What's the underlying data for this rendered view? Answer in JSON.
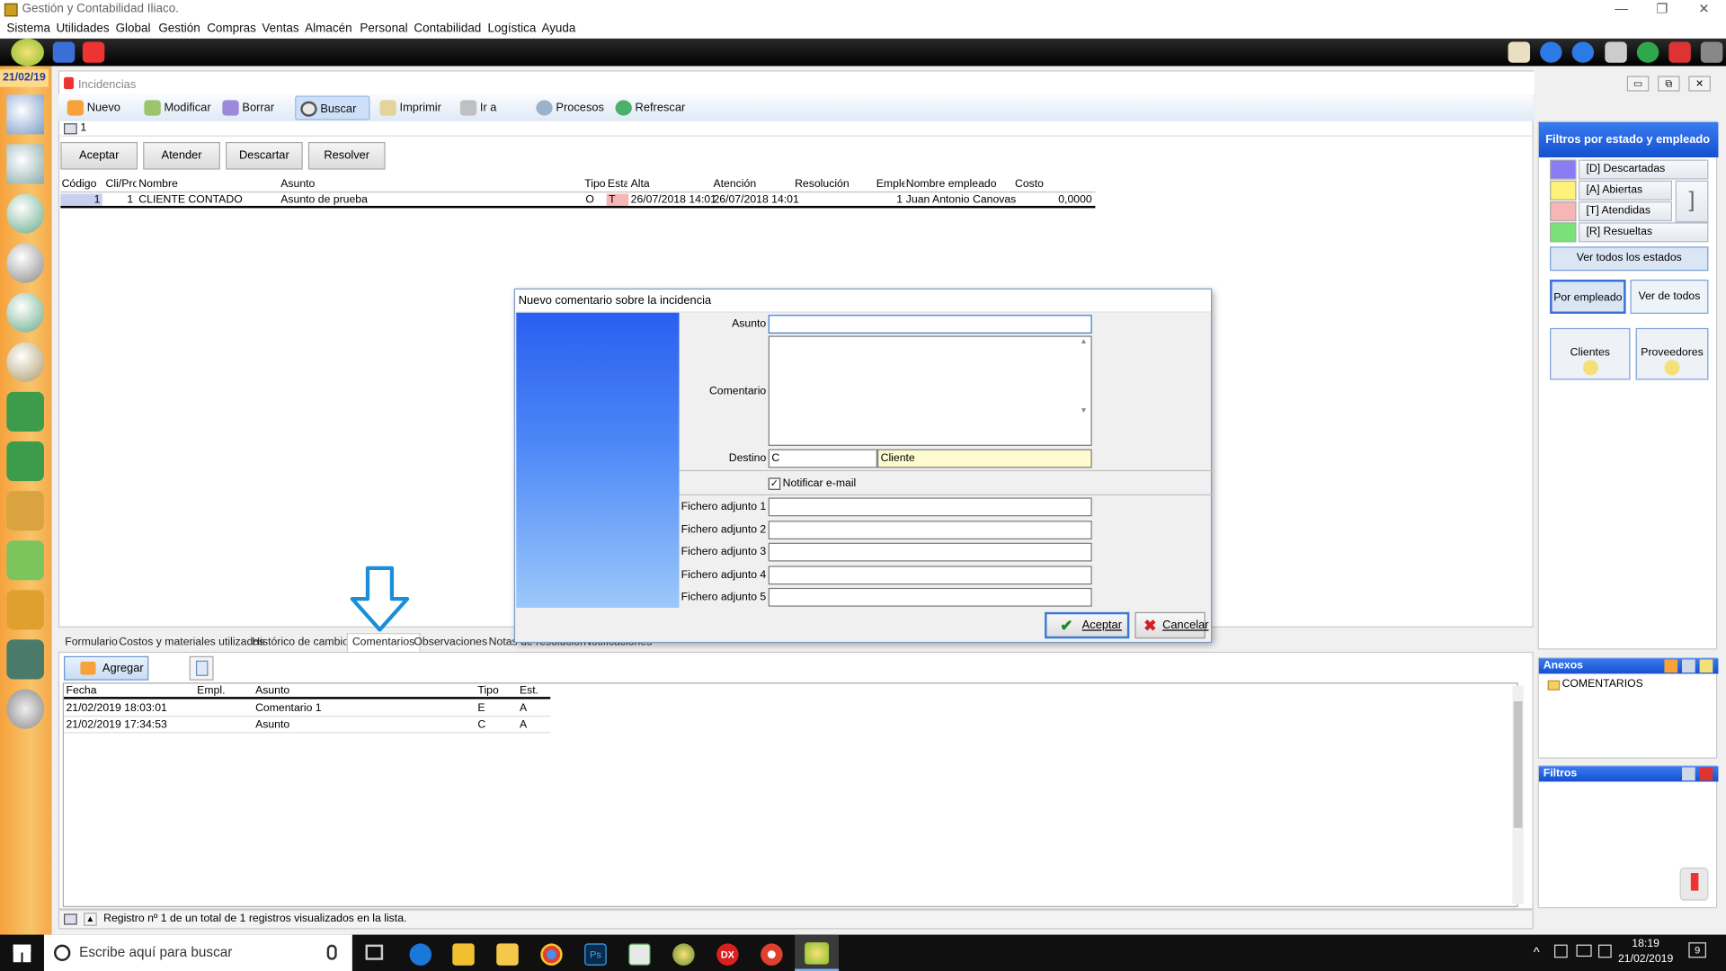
{
  "app": {
    "title": "Gestión y Contabilidad Iliaco.",
    "window_controls": [
      "—",
      "❐",
      "✕"
    ]
  },
  "menu": [
    "Sistema",
    "Utilidades",
    "Global",
    "Gestión",
    "Compras",
    "Ventas",
    "Almacén",
    "Personal",
    "Contabilidad",
    "Logística",
    "Ayuda"
  ],
  "left_date": "21/02/19",
  "inner": {
    "title": "Incidencias",
    "win_controls": [
      "▭",
      "⧉",
      "✕"
    ]
  },
  "toolbar": {
    "nuevo": "Nuevo",
    "modificar": "Modificar",
    "borrar": "Borrar",
    "buscar": "Buscar",
    "imprimir": "Imprimir",
    "ira": "Ir a",
    "procesos": "Procesos",
    "refrescar": "Refrescar"
  },
  "record_counter": "1",
  "actions": {
    "aceptar": "Aceptar",
    "atender": "Atender",
    "descartar": "Descartar",
    "resolver": "Resolver"
  },
  "grid": {
    "headers": [
      "Código",
      "Cli/Prov",
      "Nombre",
      "Asunto",
      "Tipo",
      "Estado",
      "Alta",
      "Atención",
      "Resolución",
      "Empleado",
      "Nombre empleado",
      "Costo"
    ],
    "rows": [
      [
        "1",
        "1",
        "CLIENTE CONTADO",
        "Asunto de prueba",
        "O",
        "T",
        "26/07/2018 14:01",
        "26/07/2018 14:01",
        "",
        "1",
        "Juan Antonio Canovas",
        "0,0000"
      ]
    ]
  },
  "right_panel": {
    "title": "Filtros por estado y empleado",
    "states": [
      {
        "label": "[D] Descartadas",
        "color": "#8a7cf5"
      },
      {
        "label": "[A] Abiertas",
        "color": "#fff27a"
      },
      {
        "label": "[T] Atendidas",
        "color": "#f7b6b6"
      },
      {
        "label": "[R] Resueltas",
        "color": "#7ae07a"
      }
    ],
    "ver_todos_estados": "Ver todos los estados",
    "por_empleado": "Por empleado",
    "ver_de_todos": "Ver de todos",
    "clientes": "Clientes",
    "proveedores": "Proveedores"
  },
  "bottom_tabs": [
    "Formulario",
    "Costos y materiales utilizados",
    "Histórico de cambios",
    "Comentarios",
    "Observaciones",
    "Notas de resolución",
    "Notificaciones"
  ],
  "agregar": "Agregar",
  "comments": {
    "headers": [
      "Fecha",
      "Empl.",
      "Asunto",
      "Tipo",
      "Est."
    ],
    "rows": [
      [
        "21/02/2019 18:03:01",
        "",
        "Comentario 1",
        "E",
        "A"
      ],
      [
        "21/02/2019 17:34:53",
        "",
        "Asunto",
        "C",
        "A"
      ]
    ]
  },
  "status": "Registro nº 1 de un total de 1 registros visualizados en la lista.",
  "anexos": {
    "title": "Anexos",
    "folder": "COMENTARIOS"
  },
  "filtros": {
    "title": "Filtros"
  },
  "dialog": {
    "title": "Nuevo comentario sobre la incidencia",
    "asunto_label": "Asunto",
    "asunto_value": "",
    "comentario_label": "Comentario",
    "comentario_value": "",
    "destino_label": "Destino",
    "destino_code": "C",
    "destino_name": "Cliente",
    "notificar": "Notificar e-mail",
    "notificar_checked": true,
    "adjuntos": [
      "Fichero adjunto 1",
      "Fichero adjunto 2",
      "Fichero adjunto 3",
      "Fichero adjunto 4",
      "Fichero adjunto 5"
    ],
    "aceptar": "Aceptar",
    "cancelar": "Cancelar"
  },
  "taskbar": {
    "search_placeholder": "Escribe aquí para buscar",
    "time": "18:19",
    "date": "21/02/2019",
    "notif_count": "9"
  }
}
